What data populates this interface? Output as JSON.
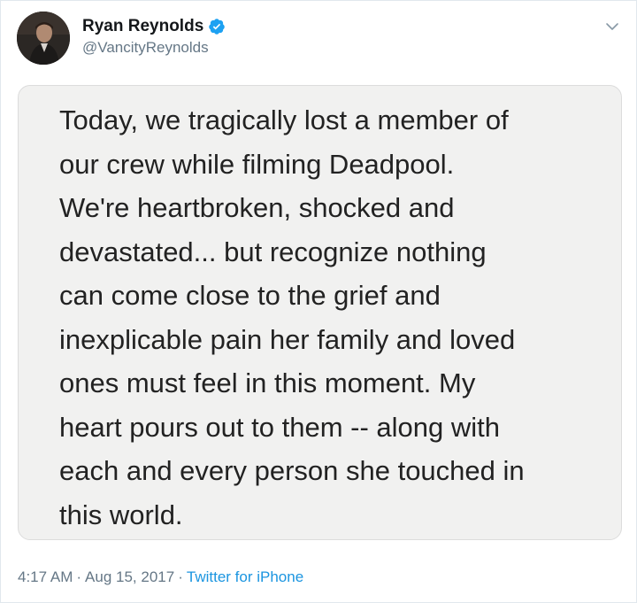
{
  "user": {
    "display_name": "Ryan Reynolds",
    "handle": "@VancityReynolds",
    "verified": true,
    "verified_icon": "verified-badge-icon",
    "avatar_icon": "profile-photo-avatar"
  },
  "menu": {
    "icon": "chevron-down-icon"
  },
  "tweet": {
    "text": "Today, we tragically lost a member of\nour crew while filming Deadpool.\nWe're heartbroken, shocked and\ndevastated... but recognize nothing\ncan come close to the grief and\ninexplicable pain her family and loved\nones must feel in this moment. My\nheart pours out to them -- along with\neach and every person she touched in\nthis world."
  },
  "meta": {
    "time": "4:17 AM",
    "separator": "·",
    "date": "Aug 15, 2017",
    "source": "Twitter for iPhone"
  },
  "colors": {
    "accent": "#1b95e0",
    "verified": "#1da1f2",
    "muted": "#657786",
    "image_bg": "#f1f1f0"
  }
}
